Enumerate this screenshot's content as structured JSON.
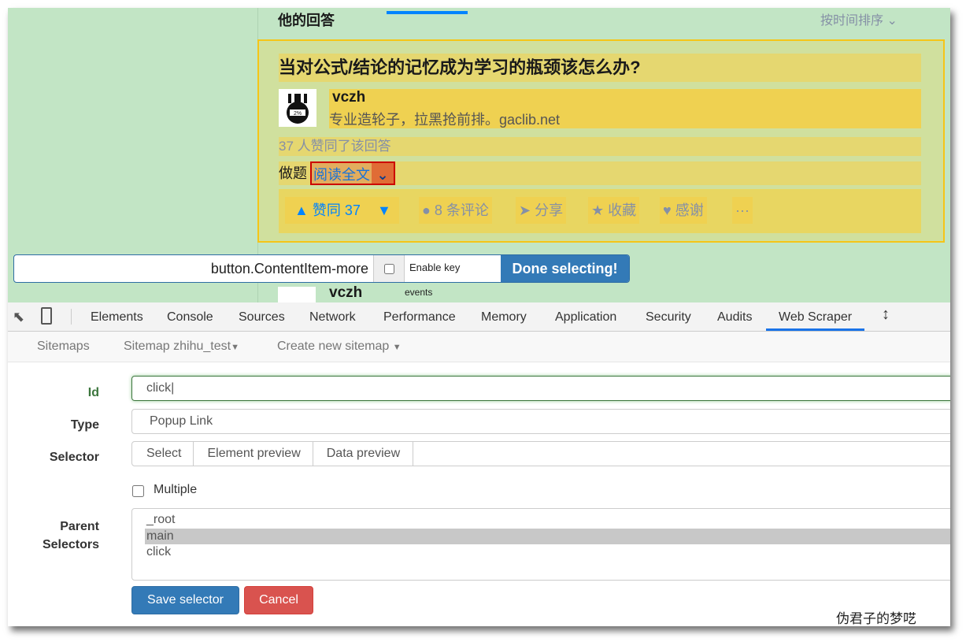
{
  "page": {
    "header_title": "他的回答",
    "sort_label": "按时间排序",
    "question": "当对公式/结论的记忆成为学习的瓶颈该怎么办?",
    "author_name": "vczh",
    "author_bio": "专业造轮子，拉黑抢前排。gaclib.net",
    "vote_summary": "37 人赞同了该回答",
    "excerpt": "做题",
    "read_more": "阅读全文",
    "actions": {
      "upvote": "▲ 赞同 37",
      "downvote": "▼",
      "comments": "8 条评论",
      "share": "分享",
      "favorite": "收藏",
      "thanks": "感谢",
      "more": "···"
    },
    "next_author": "vczh",
    "events": "events"
  },
  "selector_bar": {
    "selector": "button.ContentItem-more",
    "enable_key": "Enable key",
    "done": "Done selecting!"
  },
  "devtools": {
    "tabs": [
      "Elements",
      "Console",
      "Sources",
      "Network",
      "Performance",
      "Memory",
      "Application",
      "Security",
      "Audits",
      "Web Scraper"
    ],
    "active_tab": "Web Scraper"
  },
  "scraper": {
    "nav": {
      "sitemaps": "Sitemaps",
      "sitemap": "Sitemap zhihu_test",
      "create": "Create new sitemap"
    },
    "id_label": "Id",
    "id_value": "click",
    "type_label": "Type",
    "type_value": "Popup Link",
    "selector_label": "Selector",
    "selector_buttons": [
      "Select",
      "Element preview",
      "Data preview"
    ],
    "multiple_label": "Multiple",
    "parent_label_1": "Parent",
    "parent_label_2": "Selectors",
    "parent_options": [
      "_root",
      "main",
      "click"
    ],
    "parent_selected": "main",
    "save": "Save selector",
    "cancel": "Cancel"
  },
  "watermark": "伪君子的梦呓",
  "colors": {
    "accent": "#337ab7",
    "danger": "#d9534f",
    "zhihu_blue": "#0084ff",
    "highlight": "#f5c518"
  }
}
